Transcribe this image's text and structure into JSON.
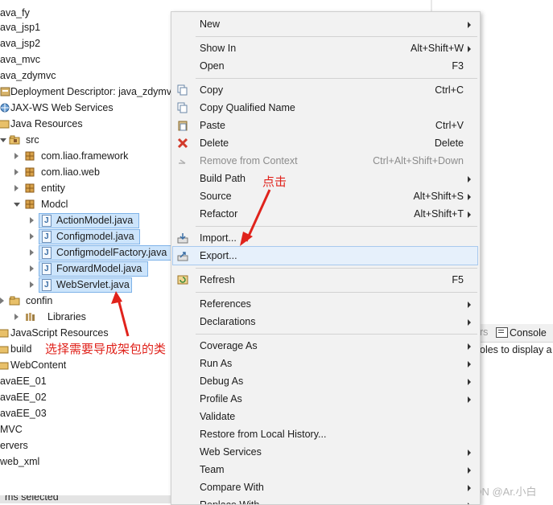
{
  "tree": {
    "items": [
      {
        "label": "ava_fy"
      },
      {
        "label": "ava_jsp1"
      },
      {
        "label": "ava_jsp2"
      },
      {
        "label": "ava_mvc"
      },
      {
        "label": "ava_zdymvc"
      },
      {
        "label": "Deployment Descriptor: java_zdymvc"
      },
      {
        "label": "JAX-WS Web Services"
      },
      {
        "label": "Java Resources"
      },
      {
        "label": "src"
      },
      {
        "label": "com.liao.framework"
      },
      {
        "label": "com.liao.web"
      },
      {
        "label": "entity"
      },
      {
        "label": "Modcl"
      },
      {
        "label": "ActionModel.java"
      },
      {
        "label": "Configmodel.java"
      },
      {
        "label": "ConfigmodelFactory.java"
      },
      {
        "label": "ForwardModel.java"
      },
      {
        "label": "WebServlet.java"
      },
      {
        "label": "confin"
      },
      {
        "label": "Libraries"
      },
      {
        "label": "JavaScript Resources"
      },
      {
        "label": "build"
      },
      {
        "label": "WebContent"
      },
      {
        "label": "avaEE_01"
      },
      {
        "label": "avaEE_02"
      },
      {
        "label": "avaEE_03"
      },
      {
        "label": "MVC"
      },
      {
        "label": "ervers"
      },
      {
        "label": "web_xml"
      }
    ],
    "status": "ms selected"
  },
  "menu": {
    "items": [
      {
        "label": "New",
        "shortcut": ""
      },
      {
        "label": "Show In",
        "shortcut": "Alt+Shift+W"
      },
      {
        "label": "Open",
        "shortcut": "F3"
      },
      {
        "label": "Copy",
        "shortcut": "Ctrl+C"
      },
      {
        "label": "Copy Qualified Name",
        "shortcut": ""
      },
      {
        "label": "Paste",
        "shortcut": "Ctrl+V"
      },
      {
        "label": "Delete",
        "shortcut": "Delete"
      },
      {
        "label": "Remove from Context",
        "shortcut": "Ctrl+Alt+Shift+Down"
      },
      {
        "label": "Build Path",
        "shortcut": ""
      },
      {
        "label": "Source",
        "shortcut": "Alt+Shift+S"
      },
      {
        "label": "Refactor",
        "shortcut": "Alt+Shift+T"
      },
      {
        "label": "Import...",
        "shortcut": ""
      },
      {
        "label": "Export...",
        "shortcut": ""
      },
      {
        "label": "Refresh",
        "shortcut": "F5"
      },
      {
        "label": "References",
        "shortcut": ""
      },
      {
        "label": "Declarations",
        "shortcut": ""
      },
      {
        "label": "Coverage As",
        "shortcut": ""
      },
      {
        "label": "Run As",
        "shortcut": ""
      },
      {
        "label": "Debug As",
        "shortcut": ""
      },
      {
        "label": "Profile As",
        "shortcut": ""
      },
      {
        "label": "Validate",
        "shortcut": ""
      },
      {
        "label": "Restore from Local History...",
        "shortcut": ""
      },
      {
        "label": "Web Services",
        "shortcut": ""
      },
      {
        "label": "Team",
        "shortcut": ""
      },
      {
        "label": "Compare With",
        "shortcut": ""
      },
      {
        "label": "Replace With",
        "shortcut": ""
      }
    ]
  },
  "panel": {
    "tab_prev": "rs",
    "console_tab": "Console",
    "console_msg": "oles to display a"
  },
  "annotations": {
    "click": "点击",
    "select_classes": "选择需要导成架包的类"
  },
  "watermark": "CSDN @Ar.小白",
  "colors": {
    "annotation": "#e0231c",
    "selection": "#cce4fb",
    "highlight": "#e6f0fb"
  }
}
